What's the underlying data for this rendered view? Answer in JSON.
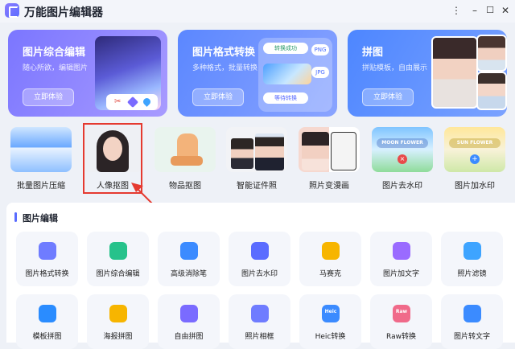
{
  "app": {
    "title": "万能图片编辑器"
  },
  "window_controls": {
    "options": "⋮",
    "minimize": "–",
    "maximize": "☐",
    "close": "✕"
  },
  "feature_cards": [
    {
      "title": "图片综合编辑",
      "subtitle": "随心所欲，编辑图片",
      "button": "立即体验",
      "color_from": "#7b76ff",
      "color_to": "#a89bff"
    },
    {
      "title": "图片格式转换",
      "subtitle": "多种格式，批量转换",
      "button": "立即体验",
      "color_from": "#5b87ff",
      "color_to": "#8aa4ff"
    },
    {
      "title": "拼图",
      "subtitle": "拼贴模板，自由展示",
      "button": "立即体验",
      "color_from": "#4d86ff",
      "color_to": "#7ba2ff"
    }
  ],
  "card_decor": {
    "convert_chips": [
      "转换成功",
      "JPG",
      "PNG",
      "等待转换"
    ]
  },
  "tools": [
    {
      "label": "批量图片压缩",
      "thumb": "blue-scene"
    },
    {
      "label": "人像抠图",
      "thumb": "portrait"
    },
    {
      "label": "物品抠图",
      "thumb": "chair"
    },
    {
      "label": "智能证件照",
      "thumb": "id-photo"
    },
    {
      "label": "照片变漫画",
      "thumb": "cartoon"
    },
    {
      "label": "图片去水印",
      "thumb": "watermark-remove",
      "overlay": "MOON FLOWER"
    },
    {
      "label": "图片加水印",
      "thumb": "watermark-add",
      "overlay": "SUN FLOWER"
    }
  ],
  "section": {
    "title": "图片编辑"
  },
  "grid_row1": [
    {
      "label": "图片格式转换",
      "icon": "convert-icon",
      "color": "#6f7cff"
    },
    {
      "label": "图片综合编辑",
      "icon": "edit-icon",
      "color": "#27c28b"
    },
    {
      "label": "高级消除笔",
      "icon": "eraser-icon",
      "color": "#3b8bff"
    },
    {
      "label": "图片去水印",
      "icon": "drop-icon",
      "color": "#5a6cff"
    },
    {
      "label": "马赛克",
      "icon": "mosaic-icon",
      "color": "#f7b500"
    },
    {
      "label": "图片加文字",
      "icon": "text-icon",
      "color": "#9a6bff"
    },
    {
      "label": "照片滤镜",
      "icon": "filter-icon",
      "color": "#3ea4ff"
    }
  ],
  "grid_row2": [
    {
      "label": "模板拼图",
      "icon": "template-icon",
      "color": "#2a8cff",
      "text": ""
    },
    {
      "label": "海报拼图",
      "icon": "poster-icon",
      "color": "#f7b500",
      "text": ""
    },
    {
      "label": "自由拼图",
      "icon": "puzzle-icon",
      "color": "#7a6bff",
      "text": ""
    },
    {
      "label": "照片相框",
      "icon": "frame-icon",
      "color": "#6f7cff",
      "text": ""
    },
    {
      "label": "Heic转换",
      "icon": "heic-icon",
      "color": "#3b8bff",
      "text": "Heic"
    },
    {
      "label": "Raw转换",
      "icon": "raw-icon",
      "color": "#f06a8a",
      "text": "Raw"
    },
    {
      "label": "图片转文字",
      "icon": "ocr-icon",
      "color": "#3b8bff",
      "text": ""
    }
  ]
}
